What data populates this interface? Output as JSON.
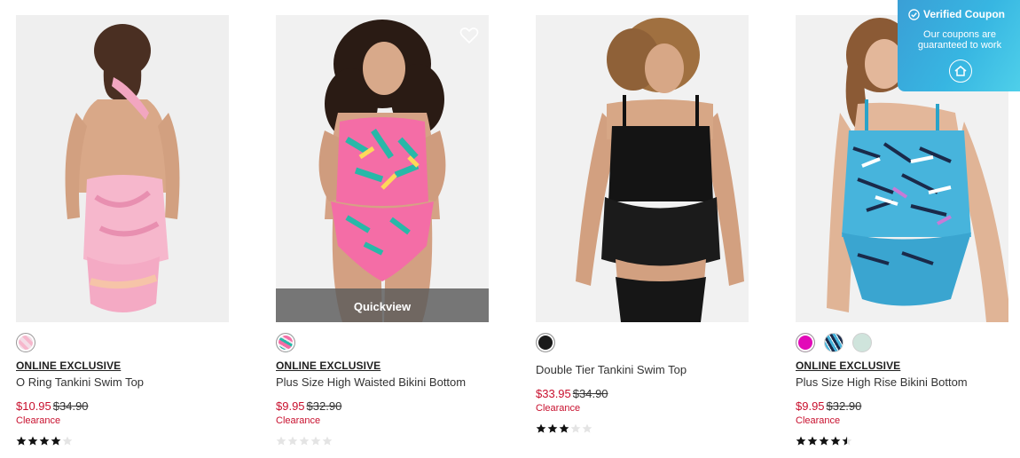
{
  "products": [
    {
      "exclusive": "ONLINE EXCLUSIVE",
      "name": "O Ring Tankini Swim Top",
      "sale_price": "$10.95",
      "orig_price": "$34.90",
      "clearance": "Clearance",
      "rating": 4,
      "swatches": [
        "pink-swirl"
      ],
      "show_quickview": false
    },
    {
      "exclusive": "ONLINE EXCLUSIVE",
      "name": "Plus Size High Waisted Bikini Bottom",
      "sale_price": "$9.95",
      "orig_price": "$32.90",
      "clearance": "Clearance",
      "rating": 0,
      "swatches": [
        "tropical-print"
      ],
      "show_quickview": true,
      "quickview_label": "Quickview"
    },
    {
      "exclusive": "",
      "name": "Double Tier Tankini Swim Top",
      "sale_price": "$33.95",
      "orig_price": "$34.90",
      "clearance": "Clearance",
      "rating": 3,
      "swatches": [
        "black"
      ],
      "show_quickview": false
    },
    {
      "exclusive": "ONLINE EXCLUSIVE",
      "name": "Plus Size High Rise Bikini Bottom",
      "sale_price": "$9.95",
      "orig_price": "$32.90",
      "clearance": "Clearance",
      "rating": 4.5,
      "swatches": [
        "magenta",
        "blue-print",
        "mint"
      ],
      "show_quickview": false
    }
  ],
  "coupon": {
    "title": "Verified Coupon",
    "subtitle": "Our coupons are guaranteed to work"
  },
  "colors": {
    "sale": "#c8102e",
    "coupon_bg": "#37b6e2"
  }
}
